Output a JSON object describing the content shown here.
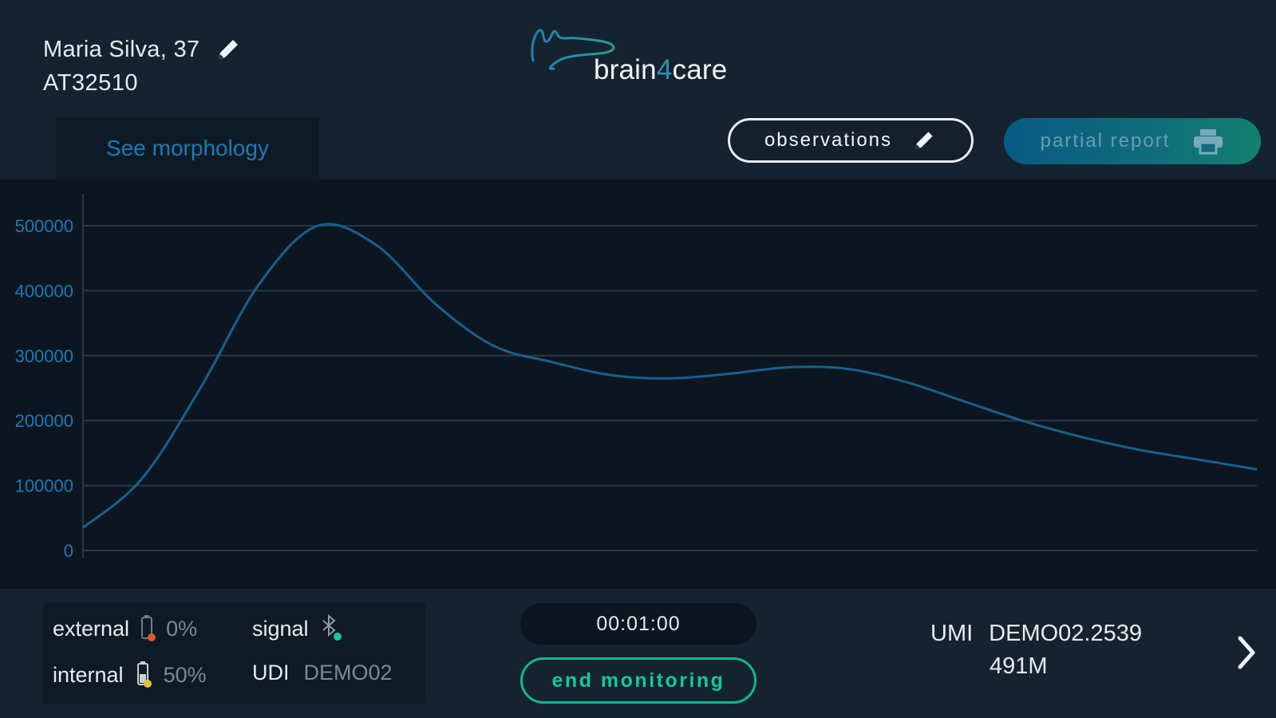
{
  "patient": {
    "name": "Maria Silva, 37",
    "id": "AT32510"
  },
  "logo": {
    "text_before": "brain",
    "text_digit": "4",
    "text_after": "care"
  },
  "tabs": {
    "morphology_label": "See morphology"
  },
  "actions": {
    "observations_label": "observations",
    "partial_report_label": "partial report"
  },
  "icons": {
    "edit": "pencil-icon",
    "print": "printer-icon",
    "bluetooth": "bluetooth-icon",
    "battery": "battery-icon",
    "next": "chevron-right-icon"
  },
  "colors": {
    "accent_blue": "#1d7ab3",
    "accent_green": "#13c99a",
    "battery_low": "#e0582a",
    "battery_mid": "#e8c23a",
    "signal_ok": "#13c99a"
  },
  "chart_data": {
    "type": "line",
    "title": "",
    "xlabel": "",
    "ylabel": "",
    "ylim": [
      0,
      500000
    ],
    "yticks": [
      "0",
      "100000",
      "200000",
      "300000",
      "400000",
      "500000"
    ],
    "grid": true,
    "series": [
      {
        "x": [
          0,
          5,
          10,
          15,
          20,
          25,
          30,
          35,
          40,
          45,
          50,
          55,
          60,
          65,
          70,
          75,
          80,
          85,
          90,
          95,
          100
        ],
        "values": [
          35000,
          110000,
          250000,
          410000,
          500000,
          470000,
          380000,
          315000,
          290000,
          270000,
          265000,
          272000,
          282000,
          280000,
          260000,
          230000,
          200000,
          175000,
          155000,
          140000,
          125000
        ]
      }
    ]
  },
  "status": {
    "external_label": "external",
    "external_value": "0%",
    "internal_label": "internal",
    "internal_value": "50%",
    "signal_label": "signal",
    "udi_label": "UDI",
    "udi_value": "DEMO02"
  },
  "monitor": {
    "timer": "00:01:00",
    "end_label": "end monitoring"
  },
  "umi": {
    "label": "UMI",
    "value_line1": "DEMO02.2539",
    "value_line2": "491M"
  }
}
